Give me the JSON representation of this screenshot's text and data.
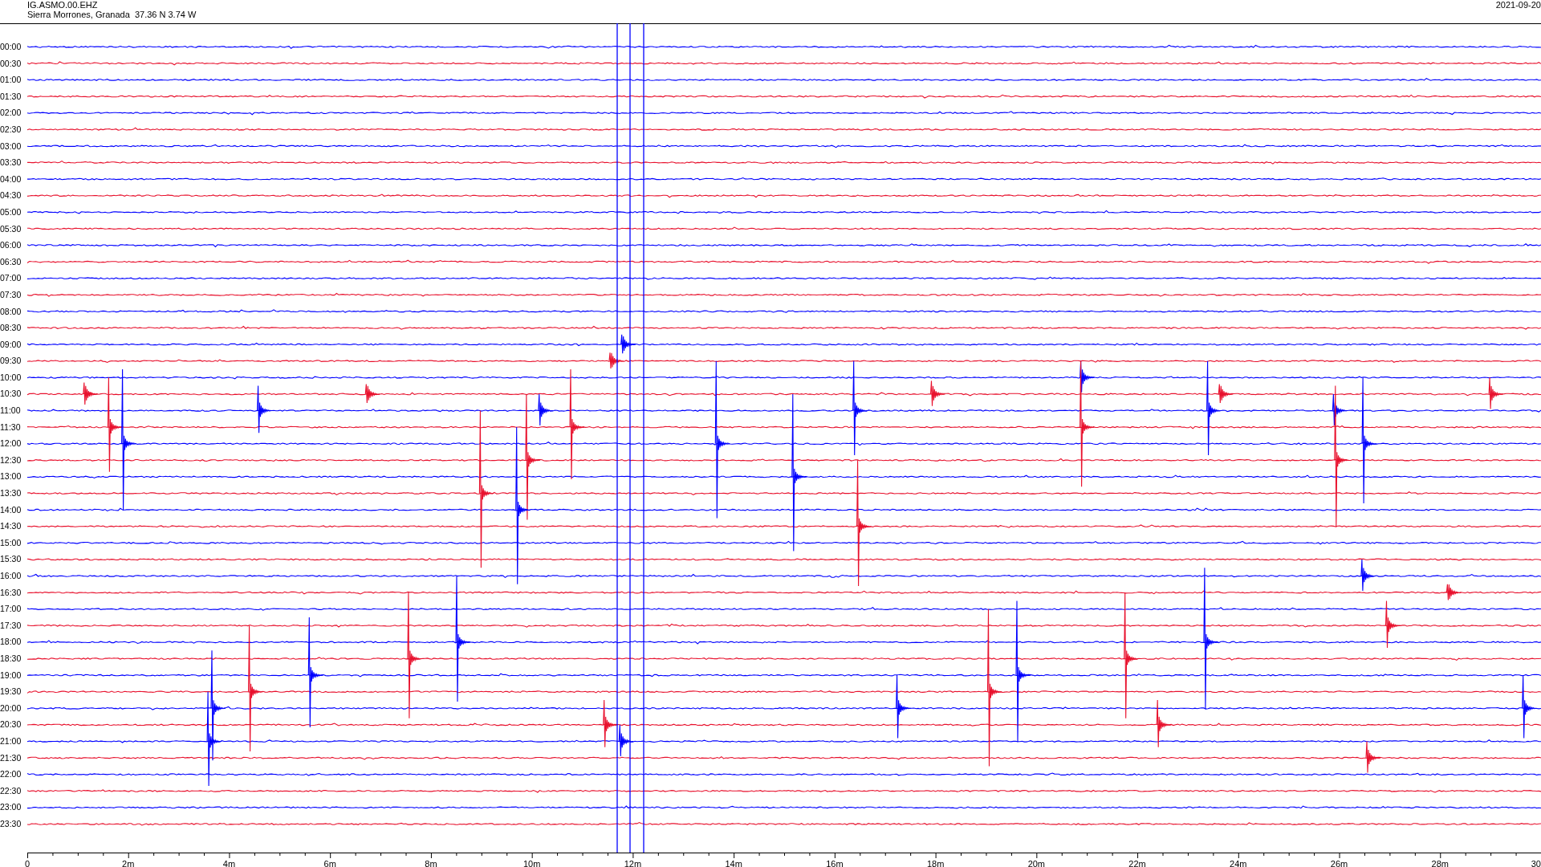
{
  "header": {
    "station": "IG.ASMO.00.EHZ",
    "location": "Sierra Morrones, Granada  37.36 N 3.74 W",
    "date": "2021-09-20"
  },
  "rows": [
    {
      "label": "00:00",
      "color": "#0000ff"
    },
    {
      "label": "00:30",
      "color": "#e8112d"
    },
    {
      "label": "01:00",
      "color": "#0000ff"
    },
    {
      "label": "01:30",
      "color": "#e8112d"
    },
    {
      "label": "02:00",
      "color": "#0000ff"
    },
    {
      "label": "02:30",
      "color": "#e8112d"
    },
    {
      "label": "03:00",
      "color": "#0000ff"
    },
    {
      "label": "03:30",
      "color": "#e8112d"
    },
    {
      "label": "04:00",
      "color": "#0000ff"
    },
    {
      "label": "04:30",
      "color": "#e8112d"
    },
    {
      "label": "05:00",
      "color": "#0000ff"
    },
    {
      "label": "05:30",
      "color": "#e8112d"
    },
    {
      "label": "06:00",
      "color": "#0000ff"
    },
    {
      "label": "06:30",
      "color": "#e8112d"
    },
    {
      "label": "07:00",
      "color": "#0000ff"
    },
    {
      "label": "07:30",
      "color": "#e8112d"
    },
    {
      "label": "08:00",
      "color": "#0000ff"
    },
    {
      "label": "08:30",
      "color": "#e8112d"
    },
    {
      "label": "09:00",
      "color": "#0000ff"
    },
    {
      "label": "09:30",
      "color": "#e8112d"
    },
    {
      "label": "10:00",
      "color": "#0000ff"
    },
    {
      "label": "10:30",
      "color": "#e8112d"
    },
    {
      "label": "11:00",
      "color": "#0000ff"
    },
    {
      "label": "11:30",
      "color": "#e8112d"
    },
    {
      "label": "12:00",
      "color": "#0000ff"
    },
    {
      "label": "12:30",
      "color": "#e8112d"
    },
    {
      "label": "13:00",
      "color": "#0000ff"
    },
    {
      "label": "13:30",
      "color": "#e8112d"
    },
    {
      "label": "14:00",
      "color": "#0000ff"
    },
    {
      "label": "14:30",
      "color": "#e8112d"
    },
    {
      "label": "15:00",
      "color": "#0000ff"
    },
    {
      "label": "15:30",
      "color": "#e8112d"
    },
    {
      "label": "16:00",
      "color": "#0000ff"
    },
    {
      "label": "16:30",
      "color": "#e8112d"
    },
    {
      "label": "17:00",
      "color": "#0000ff"
    },
    {
      "label": "17:30",
      "color": "#e8112d"
    },
    {
      "label": "18:00",
      "color": "#0000ff"
    },
    {
      "label": "18:30",
      "color": "#e8112d"
    },
    {
      "label": "19:00",
      "color": "#0000ff"
    },
    {
      "label": "19:30",
      "color": "#e8112d"
    },
    {
      "label": "20:00",
      "color": "#0000ff"
    },
    {
      "label": "20:30",
      "color": "#e8112d"
    },
    {
      "label": "21:00",
      "color": "#0000ff"
    },
    {
      "label": "21:30",
      "color": "#e8112d"
    },
    {
      "label": "22:00",
      "color": "#0000ff"
    },
    {
      "label": "22:30",
      "color": "#e8112d"
    },
    {
      "label": "23:00",
      "color": "#0000ff"
    },
    {
      "label": "23:30",
      "color": "#e8112d"
    }
  ],
  "x_axis": {
    "labels": [
      "0",
      "2m",
      "4m",
      "6m",
      "8m",
      "10m",
      "12m",
      "14m",
      "16m",
      "18m",
      "20m",
      "22m",
      "24m",
      "26m",
      "28m",
      "30"
    ]
  }
}
